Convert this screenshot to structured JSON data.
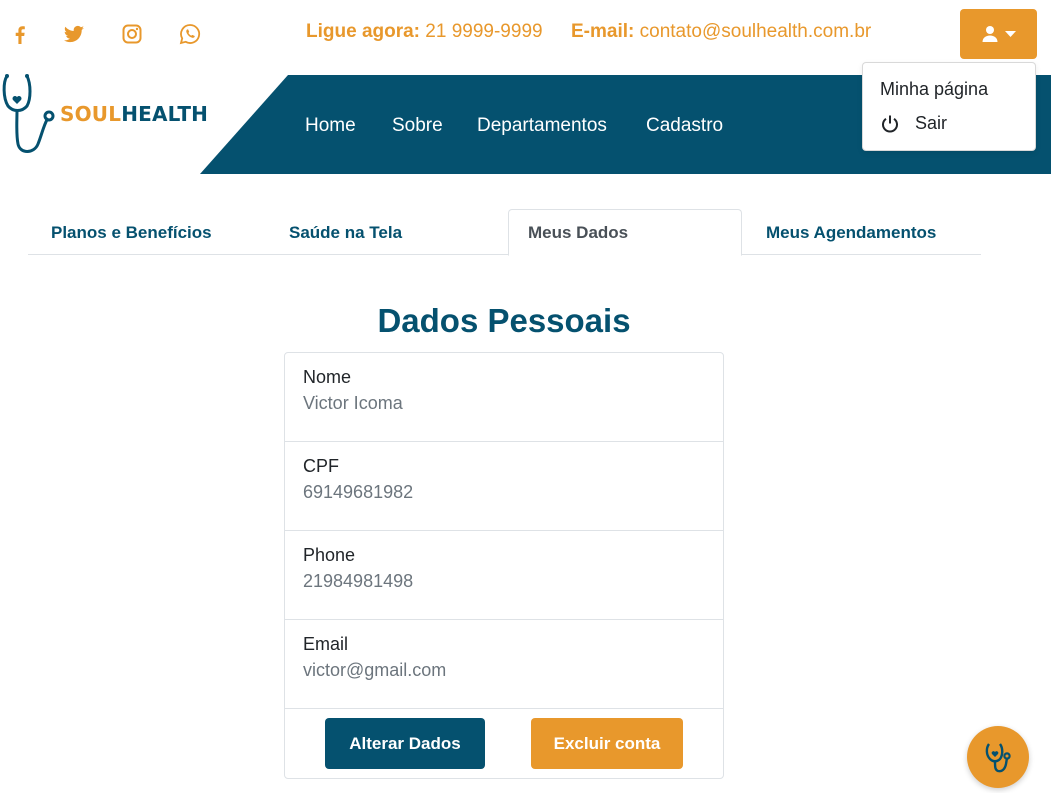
{
  "colors": {
    "primary": "#05516f",
    "accent": "#e8982c",
    "muted_text": "#6c757d"
  },
  "topbar": {
    "social": [
      "facebook-icon",
      "twitter-icon",
      "instagram-icon",
      "whatsapp-icon"
    ],
    "phone_label": "Ligue agora:",
    "phone_value": "21 9999-9999",
    "email_label": "E-mail:",
    "email_value": "contato@soulhealth.com.br",
    "user_menu_icon": "user-icon"
  },
  "user_dropdown": {
    "items": [
      {
        "label": "Minha página"
      },
      {
        "label": "Sair",
        "icon": "power-icon"
      }
    ]
  },
  "brand": {
    "soul": "SOUL",
    "health": "HEALTH"
  },
  "nav": {
    "items": [
      {
        "label": "Home"
      },
      {
        "label": "Sobre"
      },
      {
        "label": "Departamentos"
      },
      {
        "label": "Cadastro"
      }
    ]
  },
  "tabs": {
    "items": [
      {
        "label": "Planos e Benefícios"
      },
      {
        "label": "Saúde na Tela"
      },
      {
        "label": "Meus Dados",
        "active": true
      },
      {
        "label": "Meus Agendamentos"
      }
    ]
  },
  "profile": {
    "title": "Dados Pessoais",
    "fields": [
      {
        "label": "Nome",
        "value": "Victor Icoma"
      },
      {
        "label": "CPF",
        "value": "69149681982"
      },
      {
        "label": "Phone",
        "value": "21984981498"
      },
      {
        "label": "Email",
        "value": "victor@gmail.com"
      }
    ],
    "edit_button": "Alterar Dados",
    "delete_button": "Excluir conta"
  },
  "floating_button": {
    "icon": "stethoscope-icon"
  }
}
